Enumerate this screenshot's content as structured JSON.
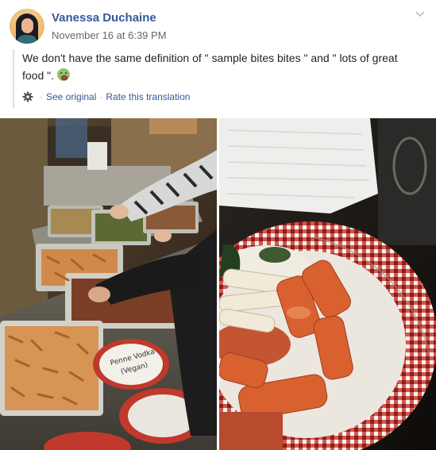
{
  "post": {
    "author": "Vanessa Duchaine",
    "timestamp": "November 16 at 6:39 PM",
    "text": "We don't have the same definition of \" sample bites bites \" and \" lots of great food \".",
    "emoji": "sick-face-emoji",
    "translation": {
      "see_original": "See original",
      "rate": "Rate this translation",
      "separator": "·"
    },
    "photos": [
      {
        "alt": "Tables with aluminum trays of pasta and food at a party"
      },
      {
        "alt": "Plate of rigatoni with tomato sauce on a red gingham paper plate"
      }
    ],
    "photo_label": "Penne Vodka (Vegan)"
  }
}
